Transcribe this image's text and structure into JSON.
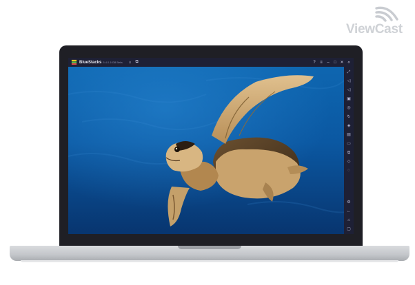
{
  "watermark": {
    "text": "ViewCast",
    "icon": "wifi-signal-icon"
  },
  "window": {
    "app_name": "BlueStacks",
    "version": "5.4.0.1038 Beta",
    "toolbar_left_icons": [
      "home-icon",
      "multi-instance-icon"
    ],
    "toolbar_right_icons": [
      "help-icon",
      "menu-icon",
      "minimize-icon",
      "maximize-icon",
      "close-icon",
      "collapse-sidebar-icon"
    ]
  },
  "sidebar": {
    "icons": [
      "fullscreen-icon",
      "volume-up-icon",
      "volume-down-icon",
      "media-manager-icon",
      "screenshot-icon",
      "rotate-icon",
      "gamepad-icon",
      "macro-icon",
      "folder-icon",
      "multi-instance-icon",
      "layers-icon",
      "eco-mode-icon"
    ],
    "bottom_icons": [
      "settings-icon",
      "back-icon",
      "home-icon",
      "recent-apps-icon"
    ]
  },
  "content": {
    "image": "sea-turtle-underwater"
  },
  "colors": {
    "titlebar": "#1e2035",
    "water_top": "#0c5fa8",
    "water_deep": "#0a3f7e",
    "bezel": "#1f1f25"
  }
}
